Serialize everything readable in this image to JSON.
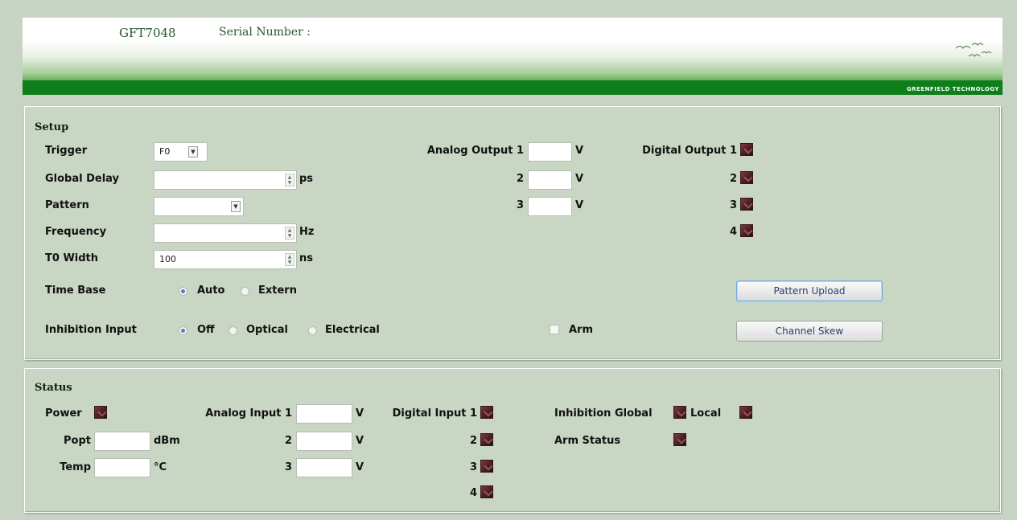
{
  "header": {
    "device": "GFT7048",
    "serial_label": "Serial Number :",
    "logo_text": "GREENFIELD TECHNOLOGY"
  },
  "setup": {
    "title": "Setup",
    "trigger": {
      "label": "Trigger",
      "value": "F0"
    },
    "global_delay": {
      "label": "Global Delay",
      "value": "",
      "unit": "ps"
    },
    "pattern": {
      "label": "Pattern",
      "value": ""
    },
    "frequency": {
      "label": "Frequency",
      "value": "",
      "unit": "Hz"
    },
    "t0_width": {
      "label": "T0 Width",
      "value": "100",
      "unit": "ns"
    },
    "time_base": {
      "label": "Time Base",
      "options": [
        "Auto",
        "Extern"
      ],
      "selected": "Auto"
    },
    "inhibition_input": {
      "label": "Inhibition Input",
      "options": [
        "Off",
        "Optical",
        "Electrical"
      ],
      "selected": "Off"
    },
    "analog_output": {
      "label": "Analog Output 1",
      "rows": [
        "2",
        "3"
      ],
      "unit": "V"
    },
    "digital_output": {
      "label": "Digital Output 1",
      "rows": [
        "2",
        "3",
        "4"
      ]
    },
    "arm": {
      "label": "Arm",
      "checked": false
    },
    "pattern_upload_button": "Pattern Upload",
    "channel_skew_button": "Channel Skew"
  },
  "status": {
    "title": "Status",
    "power": {
      "label": "Power"
    },
    "popt": {
      "label": "Popt",
      "value": "",
      "unit": "dBm"
    },
    "temp": {
      "label": "Temp",
      "value": "",
      "unit": "°C"
    },
    "analog_input": {
      "label": "Analog Input 1",
      "rows": [
        "2",
        "3"
      ],
      "unit": "V"
    },
    "digital_input": {
      "label": "Digital Input 1",
      "rows": [
        "2",
        "3",
        "4"
      ]
    },
    "inhibition": {
      "global_label": "Inhibition Global",
      "local_label": "Local"
    },
    "arm_status": {
      "label": "Arm Status"
    }
  },
  "colors": {
    "background": "#c7d3c3",
    "header_band": "#0c7e1a",
    "led": "#4d1e22",
    "button_text": "#2c3f6b"
  }
}
